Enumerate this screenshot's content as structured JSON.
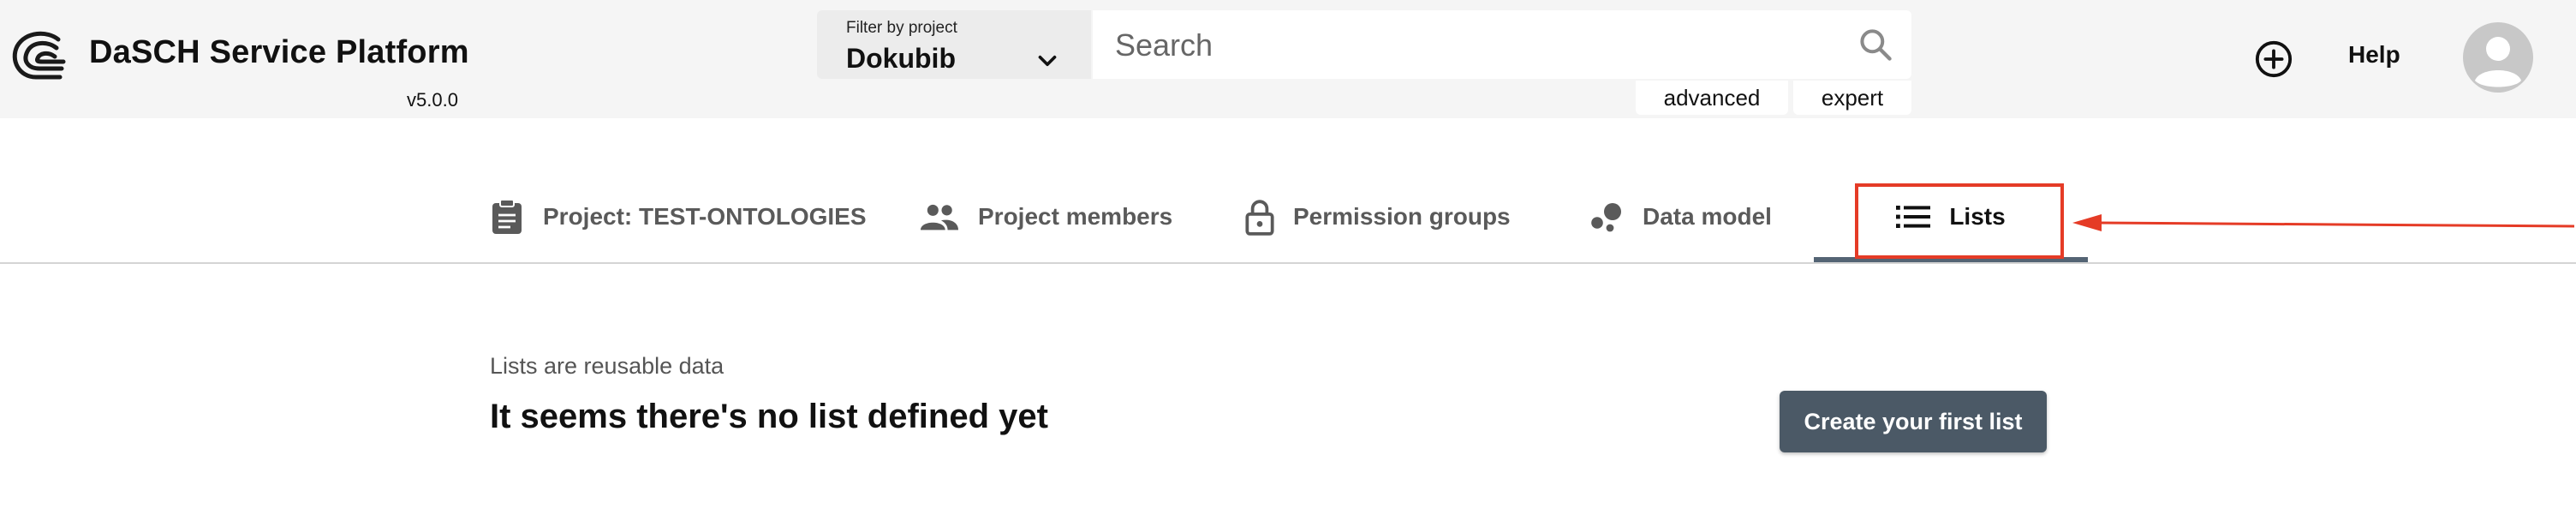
{
  "header": {
    "app_title": "DaSCH Service Platform",
    "version": "v5.0.0",
    "filter": {
      "label": "Filter by project",
      "value": "Dokubib"
    },
    "search": {
      "placeholder": "Search"
    },
    "modes": {
      "advanced": "advanced",
      "expert": "expert"
    },
    "help_label": "Help"
  },
  "tabs": [
    {
      "label": "Project: TEST-ONTOLOGIES",
      "icon": "clipboard-icon"
    },
    {
      "label": "Project members",
      "icon": "people-icon"
    },
    {
      "label": "Permission groups",
      "icon": "lock-icon"
    },
    {
      "label": "Data model",
      "icon": "bubble-chart-icon"
    },
    {
      "label": "Lists",
      "icon": "list-icon",
      "active": true
    }
  ],
  "main": {
    "description": "Lists are reusable data",
    "empty_title": "It seems there's no list defined yet",
    "create_button": "Create your first list"
  },
  "colors": {
    "header_bg": "#f5f5f5",
    "active_tab_underline": "#546474",
    "primary_button": "#4b5966",
    "annotation_red": "#e53b26"
  }
}
